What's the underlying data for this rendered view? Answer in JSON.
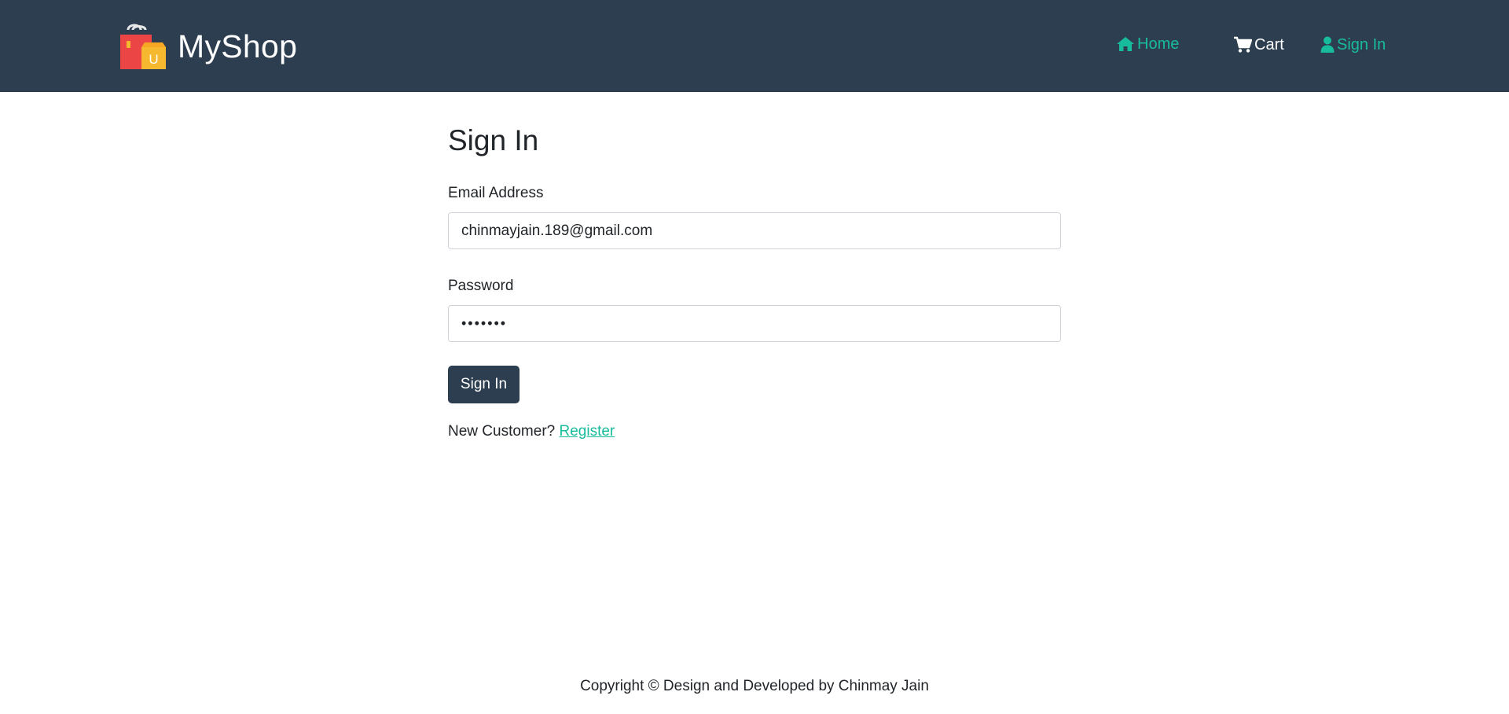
{
  "navbar": {
    "brand_name": "MyShop",
    "logo_icon": "shopping-bags-icon",
    "logo_letter": "U",
    "links": {
      "home": {
        "label": "Home",
        "icon": "home-icon"
      },
      "cart": {
        "label": "Cart",
        "icon": "cart-icon"
      },
      "signin": {
        "label": "Sign In",
        "icon": "user-icon"
      }
    }
  },
  "form": {
    "title": "Sign In",
    "email_label": "Email Address",
    "email_value": "chinmayjain.189@gmail.com",
    "password_label": "Password",
    "password_value": "•••••••",
    "submit_label": "Sign In",
    "new_customer_text": "New Customer?",
    "register_link": "Register"
  },
  "footer": {
    "text": "Copyright © Design and Developed by Chinmay Jain"
  },
  "colors": {
    "navbar_bg": "#2c3e50",
    "accent": "#18bc9c",
    "button_bg": "#2c3e50"
  }
}
